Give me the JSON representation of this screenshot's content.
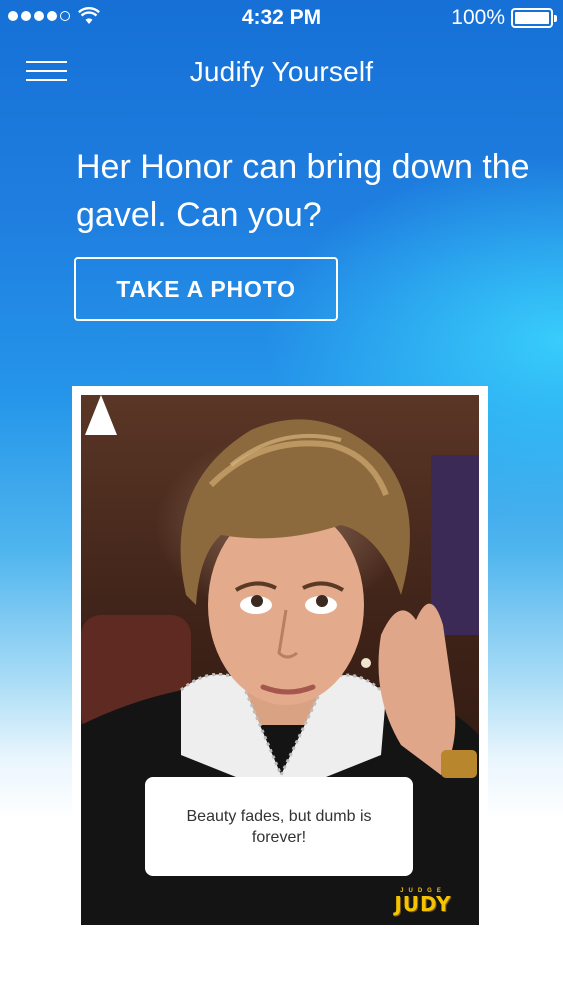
{
  "status_bar": {
    "time": "4:32 PM",
    "battery_percent": "100%",
    "signal_bars": 4,
    "signal_total": 5,
    "icons": [
      "signal-dots-icon",
      "wifi-icon",
      "battery-icon"
    ]
  },
  "nav": {
    "title": "Judify Yourself",
    "menu_icon": "hamburger-menu-icon"
  },
  "main": {
    "headline": "Her Honor can bring down the gavel. Can you?",
    "take_photo_label": "TAKE A PHOTO"
  },
  "card": {
    "caption": "Beauty fades, but dumb is forever!",
    "logo_small": "JUDGE",
    "logo_big": "JUDY"
  },
  "colors": {
    "gradient_top": "#1670d6",
    "gradient_accent": "#3cd7ff",
    "logo_yellow": "#f5c400"
  }
}
